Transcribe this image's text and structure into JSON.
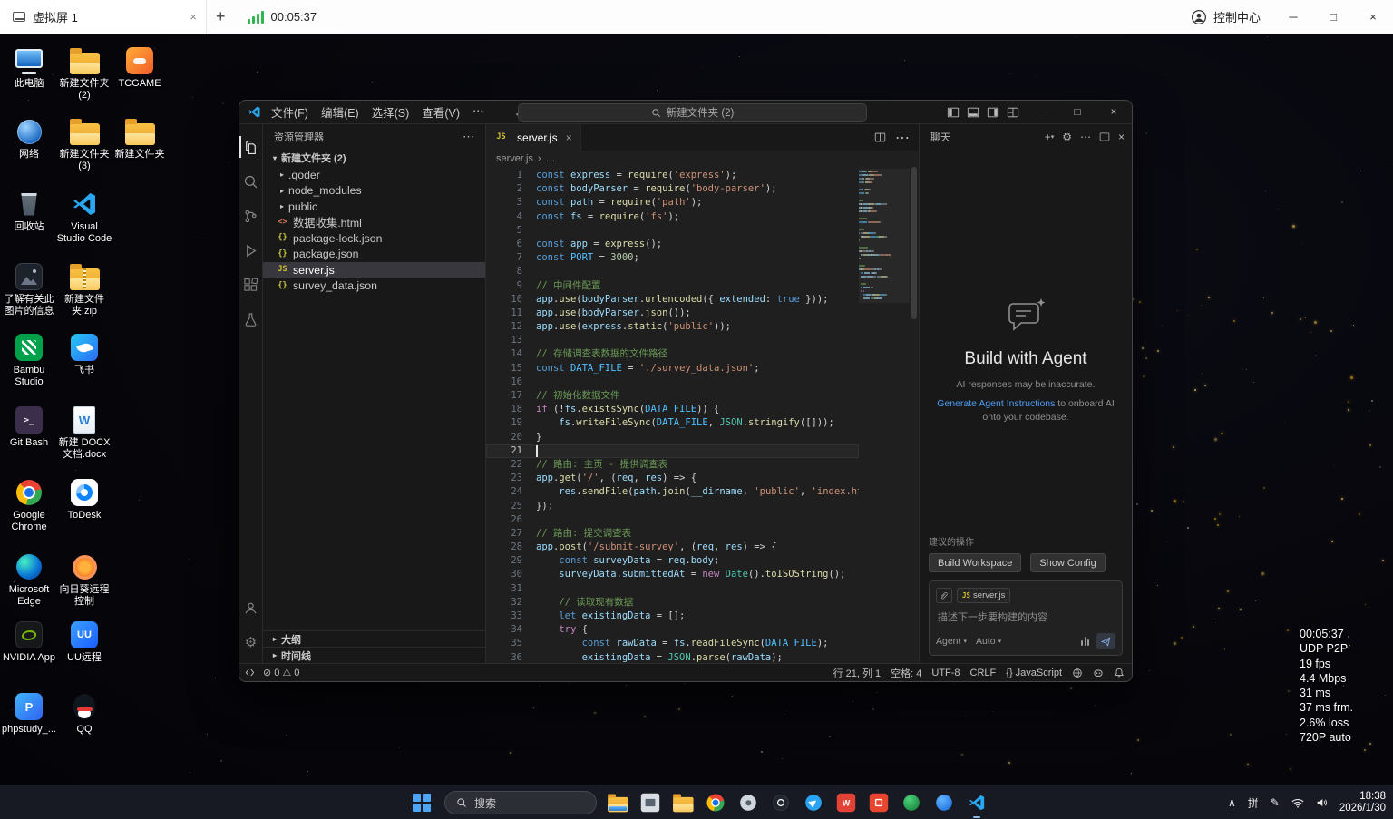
{
  "remote_bar": {
    "tab": "虚拟屏 1",
    "timer": "00:05:37",
    "control_center": "控制中心"
  },
  "desktop_icons": [
    {
      "label": "此电脑",
      "kind": "pc",
      "col": 0,
      "row": 0
    },
    {
      "label": "新建文件夹 (2)",
      "kind": "folder",
      "col": 1,
      "row": 0
    },
    {
      "label": "TCGAME",
      "kind": "tcgame",
      "col": 2,
      "row": 0
    },
    {
      "label": "网络",
      "kind": "network",
      "col": 0,
      "row": 1
    },
    {
      "label": "新建文件夹 (3)",
      "kind": "folder",
      "col": 1,
      "row": 1
    },
    {
      "label": "新建文件夹",
      "kind": "folder",
      "col": 2,
      "row": 1
    },
    {
      "label": "回收站",
      "kind": "recycle",
      "col": 0,
      "row": 2
    },
    {
      "label": "Visual Studio Code",
      "kind": "vscode",
      "col": 1,
      "row": 2
    },
    {
      "label": "了解有关此图片的信息",
      "kind": "imginfo",
      "col": 0,
      "row": 3
    },
    {
      "label": "新建文件夹.zip",
      "kind": "zip",
      "col": 1,
      "row": 3
    },
    {
      "label": "Bambu Studio",
      "kind": "bambu",
      "col": 0,
      "row": 4
    },
    {
      "label": "飞书",
      "kind": "feishu",
      "col": 1,
      "row": 4
    },
    {
      "label": "Git Bash",
      "kind": "gitbash",
      "col": 0,
      "row": 5
    },
    {
      "label": "新建 DOCX 文档.docx",
      "kind": "docx",
      "col": 1,
      "row": 5
    },
    {
      "label": "Google Chrome",
      "kind": "chrome",
      "col": 0,
      "row": 6
    },
    {
      "label": "ToDesk",
      "kind": "todesk",
      "col": 1,
      "row": 6
    },
    {
      "label": "Microsoft Edge",
      "kind": "edge",
      "col": 0,
      "row": 7
    },
    {
      "label": "向日葵远程控制",
      "kind": "sunflower",
      "col": 1,
      "row": 7
    },
    {
      "label": "NVIDIA App",
      "kind": "nvidia",
      "col": 0,
      "row": 8
    },
    {
      "label": "UU远程",
      "kind": "uu",
      "col": 1,
      "row": 8
    },
    {
      "label": "phpstudy_...",
      "kind": "phpstudy",
      "col": 0,
      "row": 9
    },
    {
      "label": "QQ",
      "kind": "qq",
      "col": 1,
      "row": 9
    }
  ],
  "vscode": {
    "menus": [
      "文件(F)",
      "编辑(E)",
      "选择(S)",
      "查看(V)"
    ],
    "menu_more": "⋯",
    "search_box": "新建文件夹 (2)",
    "explorer": {
      "title": "资源管理器",
      "root": "新建文件夹 (2)",
      "items": [
        {
          "label": ".qoder",
          "type": "folder"
        },
        {
          "label": "node_modules",
          "type": "folder"
        },
        {
          "label": "public",
          "type": "folder"
        },
        {
          "label": "数据收集.html",
          "type": "html"
        },
        {
          "label": "package-lock.json",
          "type": "json"
        },
        {
          "label": "package.json",
          "type": "json"
        },
        {
          "label": "server.js",
          "type": "js",
          "selected": true
        },
        {
          "label": "survey_data.json",
          "type": "json"
        }
      ],
      "bottom": [
        "大纲",
        "时间线"
      ]
    },
    "editor": {
      "tab": "server.js",
      "breadcrumb": "server.js",
      "breadcrumb_more": "…",
      "cursor_line": 21,
      "code": [
        [
          [
            "k",
            "const "
          ],
          [
            "v",
            "express"
          ],
          [
            "p",
            " = "
          ],
          [
            "f",
            "require"
          ],
          [
            "p",
            "("
          ],
          [
            "s",
            "'express'"
          ],
          [
            "p",
            ");"
          ]
        ],
        [
          [
            "k",
            "const "
          ],
          [
            "v",
            "bodyParser"
          ],
          [
            "p",
            " = "
          ],
          [
            "f",
            "require"
          ],
          [
            "p",
            "("
          ],
          [
            "s",
            "'body-parser'"
          ],
          [
            "p",
            ");"
          ]
        ],
        [
          [
            "k",
            "const "
          ],
          [
            "v",
            "path"
          ],
          [
            "p",
            " = "
          ],
          [
            "f",
            "require"
          ],
          [
            "p",
            "("
          ],
          [
            "s",
            "'path'"
          ],
          [
            "p",
            ");"
          ]
        ],
        [
          [
            "k",
            "const "
          ],
          [
            "v",
            "fs"
          ],
          [
            "p",
            " = "
          ],
          [
            "f",
            "require"
          ],
          [
            "p",
            "("
          ],
          [
            "s",
            "'fs'"
          ],
          [
            "p",
            ");"
          ]
        ],
        [],
        [
          [
            "k",
            "const "
          ],
          [
            "v",
            "app"
          ],
          [
            "p",
            " = "
          ],
          [
            "f",
            "express"
          ],
          [
            "p",
            "();"
          ]
        ],
        [
          [
            "k",
            "const "
          ],
          [
            "C",
            "PORT"
          ],
          [
            "p",
            " = "
          ],
          [
            "n",
            "3000"
          ],
          [
            "p",
            ";"
          ]
        ],
        [],
        [
          [
            "c",
            "// 中间件配置"
          ]
        ],
        [
          [
            "v",
            "app"
          ],
          [
            "p",
            "."
          ],
          [
            "f",
            "use"
          ],
          [
            "p",
            "("
          ],
          [
            "v",
            "bodyParser"
          ],
          [
            "p",
            "."
          ],
          [
            "f",
            "urlencoded"
          ],
          [
            "p",
            "({ "
          ],
          [
            "v",
            "extended"
          ],
          [
            "p",
            ": "
          ],
          [
            "k",
            "true"
          ],
          [
            "p",
            " }));"
          ]
        ],
        [
          [
            "v",
            "app"
          ],
          [
            "p",
            "."
          ],
          [
            "f",
            "use"
          ],
          [
            "p",
            "("
          ],
          [
            "v",
            "bodyParser"
          ],
          [
            "p",
            "."
          ],
          [
            "f",
            "json"
          ],
          [
            "p",
            "());"
          ]
        ],
        [
          [
            "v",
            "app"
          ],
          [
            "p",
            "."
          ],
          [
            "f",
            "use"
          ],
          [
            "p",
            "("
          ],
          [
            "v",
            "express"
          ],
          [
            "p",
            "."
          ],
          [
            "f",
            "static"
          ],
          [
            "p",
            "("
          ],
          [
            "s",
            "'public'"
          ],
          [
            "p",
            "));"
          ]
        ],
        [],
        [
          [
            "c",
            "// 存储调查表数据的文件路径"
          ]
        ],
        [
          [
            "k",
            "const "
          ],
          [
            "C",
            "DATA_FILE"
          ],
          [
            "p",
            " = "
          ],
          [
            "s",
            "'./survey_data.json'"
          ],
          [
            "p",
            ";"
          ]
        ],
        [],
        [
          [
            "c",
            "// 初始化数据文件"
          ]
        ],
        [
          [
            "kc",
            "if"
          ],
          [
            "p",
            " (!"
          ],
          [
            "v",
            "fs"
          ],
          [
            "p",
            "."
          ],
          [
            "f",
            "existsSync"
          ],
          [
            "p",
            "("
          ],
          [
            "C",
            "DATA_FILE"
          ],
          [
            "p",
            ")) {"
          ]
        ],
        [
          [
            "p",
            "    "
          ],
          [
            "v",
            "fs"
          ],
          [
            "p",
            "."
          ],
          [
            "f",
            "writeFileSync"
          ],
          [
            "p",
            "("
          ],
          [
            "C",
            "DATA_FILE"
          ],
          [
            "p",
            ", "
          ],
          [
            "cl",
            "JSON"
          ],
          [
            "p",
            "."
          ],
          [
            "f",
            "stringify"
          ],
          [
            "p",
            "([]));"
          ]
        ],
        [
          [
            "p",
            "}"
          ]
        ],
        [],
        [
          [
            "c",
            "// 路由: 主页 - 提供调查表"
          ]
        ],
        [
          [
            "v",
            "app"
          ],
          [
            "p",
            "."
          ],
          [
            "f",
            "get"
          ],
          [
            "p",
            "("
          ],
          [
            "s",
            "'/'"
          ],
          [
            "p",
            ", ("
          ],
          [
            "v",
            "req"
          ],
          [
            "p",
            ", "
          ],
          [
            "v",
            "res"
          ],
          [
            "p",
            ") => {"
          ]
        ],
        [
          [
            "p",
            "    "
          ],
          [
            "v",
            "res"
          ],
          [
            "p",
            "."
          ],
          [
            "f",
            "sendFile"
          ],
          [
            "p",
            "("
          ],
          [
            "v",
            "path"
          ],
          [
            "p",
            "."
          ],
          [
            "f",
            "join"
          ],
          [
            "p",
            "("
          ],
          [
            "v",
            "__dirname"
          ],
          [
            "p",
            ", "
          ],
          [
            "s",
            "'public'"
          ],
          [
            "p",
            ", "
          ],
          [
            "s",
            "'index.html"
          ]
        ],
        [
          [
            "p",
            "});"
          ]
        ],
        [],
        [
          [
            "c",
            "// 路由: 提交调查表"
          ]
        ],
        [
          [
            "v",
            "app"
          ],
          [
            "p",
            "."
          ],
          [
            "f",
            "post"
          ],
          [
            "p",
            "("
          ],
          [
            "s",
            "'/submit-survey'"
          ],
          [
            "p",
            ", ("
          ],
          [
            "v",
            "req"
          ],
          [
            "p",
            ", "
          ],
          [
            "v",
            "res"
          ],
          [
            "p",
            ") => {"
          ]
        ],
        [
          [
            "p",
            "    "
          ],
          [
            "k",
            "const "
          ],
          [
            "v",
            "surveyData"
          ],
          [
            "p",
            " = "
          ],
          [
            "v",
            "req"
          ],
          [
            "p",
            "."
          ],
          [
            "v",
            "body"
          ],
          [
            "p",
            ";"
          ]
        ],
        [
          [
            "p",
            "    "
          ],
          [
            "v",
            "surveyData"
          ],
          [
            "p",
            "."
          ],
          [
            "v",
            "submittedAt"
          ],
          [
            "p",
            " = "
          ],
          [
            "kc",
            "new "
          ],
          [
            "cl",
            "Date"
          ],
          [
            "p",
            "()."
          ],
          [
            "f",
            "toISOString"
          ],
          [
            "p",
            "();"
          ]
        ],
        [],
        [
          [
            "p",
            "    "
          ],
          [
            "c",
            "// 读取现有数据"
          ]
        ],
        [
          [
            "p",
            "    "
          ],
          [
            "k",
            "let "
          ],
          [
            "v",
            "existingData"
          ],
          [
            "p",
            " = [];"
          ]
        ],
        [
          [
            "p",
            "    "
          ],
          [
            "kc",
            "try"
          ],
          [
            "p",
            " {"
          ]
        ],
        [
          [
            "p",
            "        "
          ],
          [
            "k",
            "const "
          ],
          [
            "v",
            "rawData"
          ],
          [
            "p",
            " = "
          ],
          [
            "v",
            "fs"
          ],
          [
            "p",
            "."
          ],
          [
            "f",
            "readFileSync"
          ],
          [
            "p",
            "("
          ],
          [
            "C",
            "DATA_FILE"
          ],
          [
            "p",
            ");"
          ]
        ],
        [
          [
            "p",
            "        "
          ],
          [
            "v",
            "existingData"
          ],
          [
            "p",
            " = "
          ],
          [
            "cl",
            "JSON"
          ],
          [
            "p",
            "."
          ],
          [
            "f",
            "parse"
          ],
          [
            "p",
            "("
          ],
          [
            "v",
            "rawData"
          ],
          [
            "p",
            ");"
          ]
        ]
      ]
    },
    "chat": {
      "title": "聊天",
      "hero_title": "Build with Agent",
      "hero_note": "AI responses may be inaccurate.",
      "link": "Generate Agent Instructions",
      "link_rest": " to onboard AI onto your codebase.",
      "suggested": "建议的操作",
      "actions": [
        "Build Workspace",
        "Show Config"
      ],
      "attachment": "server.js",
      "placeholder": "描述下一步要构建的内容",
      "mode": "Agent",
      "model": "Auto"
    },
    "status": {
      "errors": "0",
      "warnings": "0",
      "line_col": "行 21, 列 1",
      "indent": "空格: 4",
      "encoding": "UTF-8",
      "eol": "CRLF",
      "lang": "JavaScript"
    }
  },
  "stats_overlay": [
    "00:05:37",
    "UDP P2P",
    "19 fps",
    "4.4 Mbps",
    "31 ms",
    "37 ms frm.",
    "2.6% loss",
    "720P auto"
  ],
  "taskbar": {
    "search": "搜索",
    "ime": "拼",
    "time": "18:38",
    "date": "2026/1/30",
    "apps": [
      {
        "name": "file-explorer",
        "kind": "explorer"
      },
      {
        "name": "app-window",
        "kind": "window"
      },
      {
        "name": "folder",
        "kind": "folder"
      },
      {
        "name": "chrome",
        "kind": "chrome"
      },
      {
        "name": "app-gray",
        "kind": "gray"
      },
      {
        "name": "app-dark",
        "kind": "dark"
      },
      {
        "name": "app-blue",
        "kind": "blue"
      },
      {
        "name": "wps",
        "kind": "wps"
      },
      {
        "name": "app-red",
        "kind": "red"
      },
      {
        "name": "app-green",
        "kind": "green"
      },
      {
        "name": "app-blue-circle",
        "kind": "bluecircle"
      },
      {
        "name": "vscode",
        "kind": "vscode",
        "active": true
      }
    ]
  }
}
